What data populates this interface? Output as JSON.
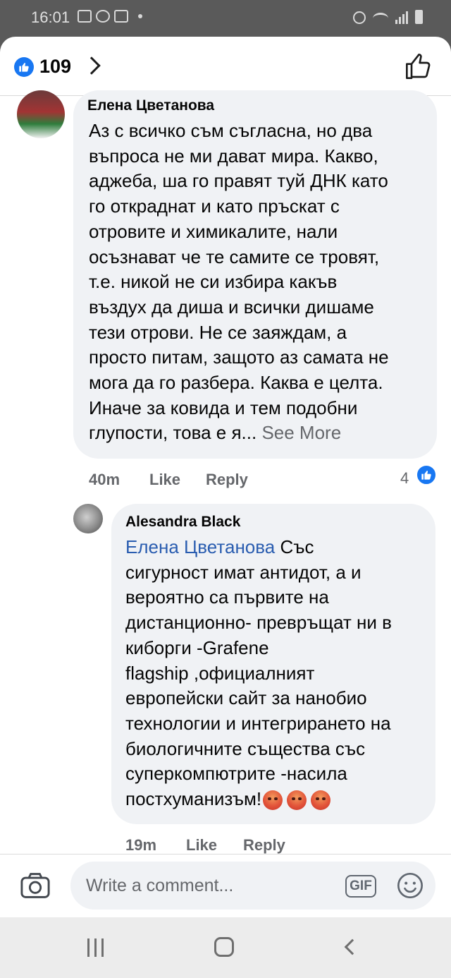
{
  "status_bar": {
    "time": "16:01",
    "left_icons": [
      "gallery-icon",
      "viber-icon",
      "gmail-icon",
      "dot-icon"
    ],
    "right_icons": [
      "alarm-icon",
      "wifi-icon",
      "signal-icon",
      "battery-icon"
    ]
  },
  "header": {
    "like_count": "109",
    "icons": [
      "like-badge-icon",
      "chevron-right-icon",
      "thumbs-up-outline-icon"
    ]
  },
  "comments": [
    {
      "author": "Елена Цветанова",
      "text": "Аз с всичко съм съгласна, но два\nвъпроса не ми дават мира. Какво,\nаджеба, ша го правят туй ДНК като\nго откраднат и като пръскат с\nотровите и химикалите, нали\nосъзнават че те самите се тровят,\nт.е. никой не си избира какъв\nвъздух да диша и всички дишаме\nтези отрови. Не се заяждам, а\nпросто питам, защото аз самата не\nмога да го разбера. Каква е целта.\nИначе за ковида и тем подобни\nглупости, това е я...",
      "see_more": " See More",
      "time": "40m",
      "like_label": "Like",
      "reply_label": "Reply",
      "reaction_count": "4"
    },
    {
      "author": "Alesandra Black",
      "mention": "Елена Цветанова",
      "text": " Със\nсигурност имат антидот, а и\nвероятно са първите на\nдистанционно- превръщат ни в\nкиборги -Grafene\nflagship ,официалният\nевропейски сайт за нанобио\nтехнологии и интегрирането на\nбиологичните същества със\nсуперкомпютрите -насила\nпостхуманизъм!",
      "emoji": [
        "angry-face-icon",
        "angry-face-icon",
        "angry-face-icon"
      ],
      "time": "19m",
      "like_label": "Like",
      "reply_label": "Reply"
    }
  ],
  "composer": {
    "placeholder": "Write a comment...",
    "gif_label": "GIF",
    "icons": [
      "camera-icon",
      "gif-icon",
      "smiley-icon"
    ]
  },
  "nav_bar": {
    "icons": [
      "recents-icon",
      "home-icon",
      "back-icon"
    ]
  },
  "colors": {
    "brand_blue": "#1877f2",
    "mention_blue": "#2a5db0",
    "bubble_gray": "#f0f2f5",
    "meta_gray": "#65676b"
  }
}
